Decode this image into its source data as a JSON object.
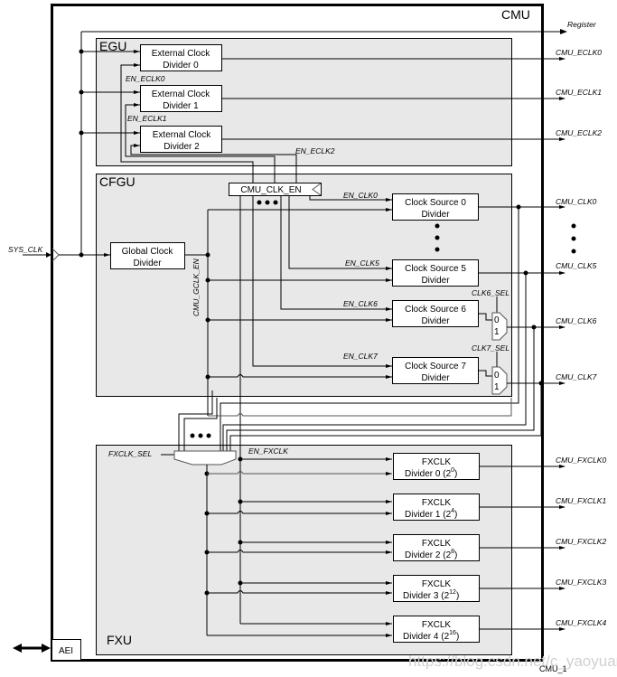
{
  "diagram": {
    "module_title": "CMU",
    "figure_id": "CMU_1",
    "watermark": "https://blog.csdn.net/c_yaoyuan",
    "colors": {
      "line": "#000000",
      "block_fill": "#e8e8e8",
      "box_fill": "#ffffff",
      "watermark": "#d0d0d0"
    },
    "inputs": {
      "sys_clk": "SYS_CLK"
    },
    "outputs": {
      "register": "Register",
      "eclk": [
        "CMU_ECLK0",
        "CMU_ECLK1",
        "CMU_ECLK2"
      ],
      "clk": [
        "CMU_CLK0",
        "CMU_CLK5",
        "CMU_CLK6",
        "CMU_CLK7"
      ],
      "fxclk": [
        "CMU_FXCLK0",
        "CMU_FXCLK1",
        "CMU_FXCLK2",
        "CMU_FXCLK3",
        "CMU_FXCLK4"
      ]
    },
    "egu": {
      "label": "EGU",
      "dividers": [
        {
          "line1": "External Clock",
          "line2": "Divider 0",
          "enable": "EN_ECLK0"
        },
        {
          "line1": "External Clock",
          "line2": "Divider 1",
          "enable": "EN_ECLK1"
        },
        {
          "line1": "External Clock",
          "line2": "Divider 2",
          "enable": "EN_ECLK2"
        }
      ]
    },
    "cfgu": {
      "label": "CFGU",
      "clk_en_block": "CMU_CLK_EN",
      "global_divider": {
        "line1": "Global Clock",
        "line2": "Divider"
      },
      "gclk_enable": "CMU_GCLK_EN",
      "sources": [
        {
          "line1": "Clock Source 0",
          "line2": "Divider",
          "enable": "EN_CLK0"
        },
        {
          "line1": "Clock Source 5",
          "line2": "Divider",
          "enable": "EN_CLK5"
        },
        {
          "line1": "Clock Source 6",
          "line2": "Divider",
          "enable": "EN_CLK6",
          "select": "CLK6_SEL"
        },
        {
          "line1": "Clock Source 7",
          "line2": "Divider",
          "enable": "EN_CLK7",
          "select": "CLK7_SEL"
        }
      ],
      "mux_inputs": [
        "0",
        "1"
      ]
    },
    "fxu": {
      "label": "FXU",
      "select": "FXCLK_SEL",
      "enable": "EN_FXCLK",
      "dividers": [
        {
          "line1": "FXCLK",
          "line2": "Divider 0 (2",
          "exp": "0",
          "close": ")"
        },
        {
          "line1": "FXCLK",
          "line2": "Divider 1 (2",
          "exp": "4",
          "close": ")"
        },
        {
          "line1": "FXCLK",
          "line2": "Divider 2 (2",
          "exp": "8",
          "close": ")"
        },
        {
          "line1": "FXCLK",
          "line2": "Divider 3 (2",
          "exp": "12",
          "close": ")"
        },
        {
          "line1": "FXCLK",
          "line2": "Divider 4 (2",
          "exp": "16",
          "close": ")"
        }
      ]
    },
    "bus_interface": "AEI"
  }
}
